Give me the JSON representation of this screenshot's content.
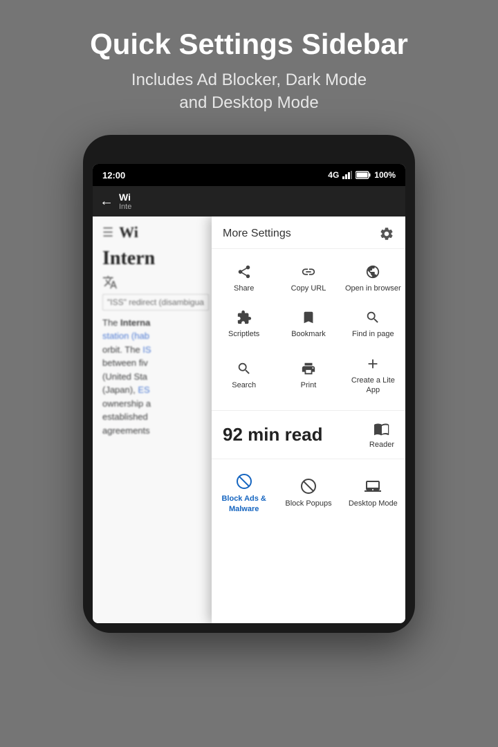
{
  "header": {
    "title": "Quick Settings Sidebar",
    "subtitle_line1": "Includes Ad Blocker, Dark Mode",
    "subtitle_line2": "and Desktop Mode"
  },
  "status_bar": {
    "time": "12:00",
    "network": "4G",
    "battery": "100%"
  },
  "browser": {
    "page_title": "Wi",
    "page_url": "Inte",
    "back_label": "←"
  },
  "web_page": {
    "title": "Intern",
    "redirect_note": "\"ISS\" redirect (disambigua",
    "paragraph": "The Interna station (hab orbit. The IS between fiv (United Sta (Japan), ES ownership a established agreements"
  },
  "context_menu": {
    "title": "More Settings",
    "items": [
      {
        "id": "share",
        "label": "Share"
      },
      {
        "id": "copy-url",
        "label": "Copy URL"
      },
      {
        "id": "open-in-browser",
        "label": "Open in browser"
      },
      {
        "id": "scriptlets",
        "label": "Scriptlets"
      },
      {
        "id": "bookmark",
        "label": "Bookmark"
      },
      {
        "id": "find-in-page",
        "label": "Find in page"
      },
      {
        "id": "search",
        "label": "Search"
      },
      {
        "id": "print",
        "label": "Print"
      },
      {
        "id": "create-lite-app",
        "label": "Create a Lite App"
      }
    ],
    "reading_time": "92 min read",
    "reader_label": "Reader",
    "bottom_items": [
      {
        "id": "block-ads-malware",
        "label": "Block Ads & Malware",
        "active": true
      },
      {
        "id": "block-popups",
        "label": "Block Popups",
        "active": false
      },
      {
        "id": "desktop-mode",
        "label": "Desktop Mode",
        "active": false
      }
    ]
  }
}
